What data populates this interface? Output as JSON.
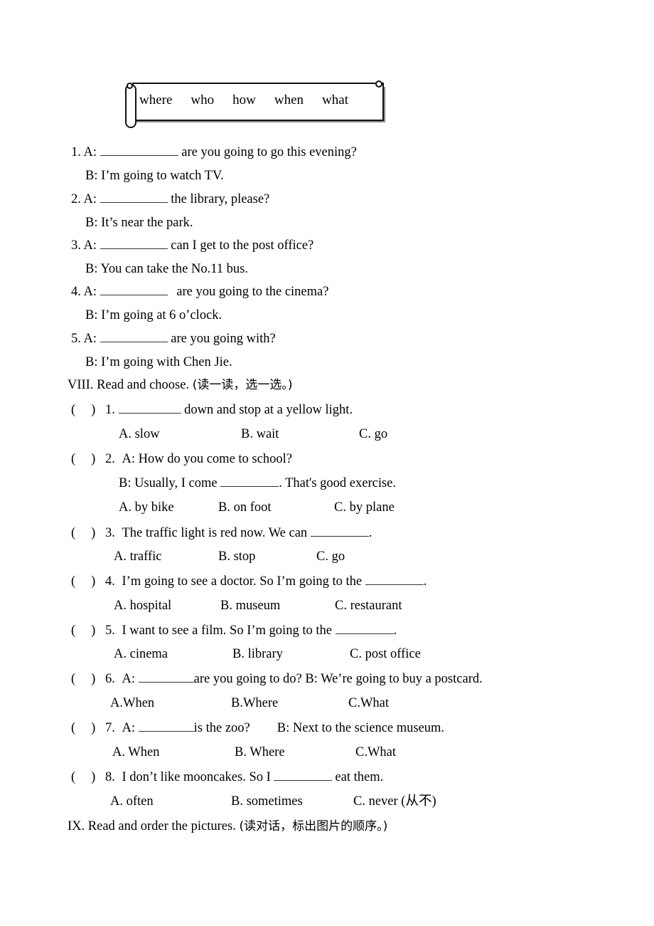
{
  "word_bank": {
    "words": [
      "where",
      "who",
      "how",
      "when",
      "what"
    ]
  },
  "dialogue_section": {
    "items": [
      {
        "num": "1. A:",
        "after_blank": "are you going to go this evening?",
        "answer_line": "B: I’m going to watch TV."
      },
      {
        "num": "2. A:",
        "after_blank": "the library, please?",
        "answer_line": "B: It’s near the park."
      },
      {
        "num": "3. A:",
        "after_blank": "can I get to the post office?",
        "answer_line": "B: You can take the No.11 bus."
      },
      {
        "num": "4. A:",
        "after_blank": "are you going to the cinema?",
        "answer_line": "B: I’m going at 6 o’clock."
      },
      {
        "num": "5. A:",
        "after_blank": "are you going with?",
        "answer_line": "B: I’m going with Chen Jie."
      }
    ]
  },
  "section_viii": {
    "heading_en": "VIII. Read and choose. ",
    "heading_cn": "(读一读，选一选。)",
    "bracket_open": "(",
    "bracket_close": ")",
    "questions": [
      {
        "num": "1.",
        "pre_blank": "",
        "post_blank": "down and stop at a yellow light.",
        "options": [
          "A. slow",
          "B. wait",
          "C. go"
        ]
      },
      {
        "num": "2.",
        "pre_blank": "A: How do you come to school?",
        "post_blank": "",
        "sub_line_pre": "B: Usually, I come ",
        "sub_line_post": ". That's good exercise.",
        "options": [
          "A. by bike",
          "B. on foot",
          "C. by plane"
        ]
      },
      {
        "num": "3.",
        "pre_blank": "The traffic light is red now. We can ",
        "post_blank": ".",
        "options": [
          "A. traffic",
          "B. stop",
          "C. go"
        ]
      },
      {
        "num": "4.",
        "pre_blank": "I’m going to see a doctor. So I’m going to the ",
        "post_blank": ".",
        "options": [
          "A. hospital",
          "B. museum",
          "C. restaurant"
        ]
      },
      {
        "num": "5.",
        "pre_blank": "I want to see a film. So I’m going to the ",
        "post_blank": ".",
        "options": [
          "A. cinema",
          "B. library",
          "C. post office"
        ]
      },
      {
        "num": "6.",
        "pre_blank": "A: ",
        "post_blank": "are you going to do? B: We’re going to buy a postcard.",
        "options": [
          "A.When",
          "B.Where",
          "C.What"
        ]
      },
      {
        "num": "7.",
        "pre_blank": "A: ",
        "post_blank": "is the zoo?",
        "post_blank_extra": "B: Next to the science museum.",
        "options": [
          "A. When",
          "B. Where",
          "C.What"
        ]
      },
      {
        "num": "8.",
        "pre_blank": "I don’t like mooncakes. So I ",
        "post_blank": "eat them.",
        "options": [
          "A. often",
          "B. sometimes",
          "C. never (从不)"
        ]
      }
    ]
  },
  "section_ix": {
    "heading_en": "IX. Read and order the pictures. ",
    "heading_cn": "(读对话，标出图片的顺序。)"
  }
}
